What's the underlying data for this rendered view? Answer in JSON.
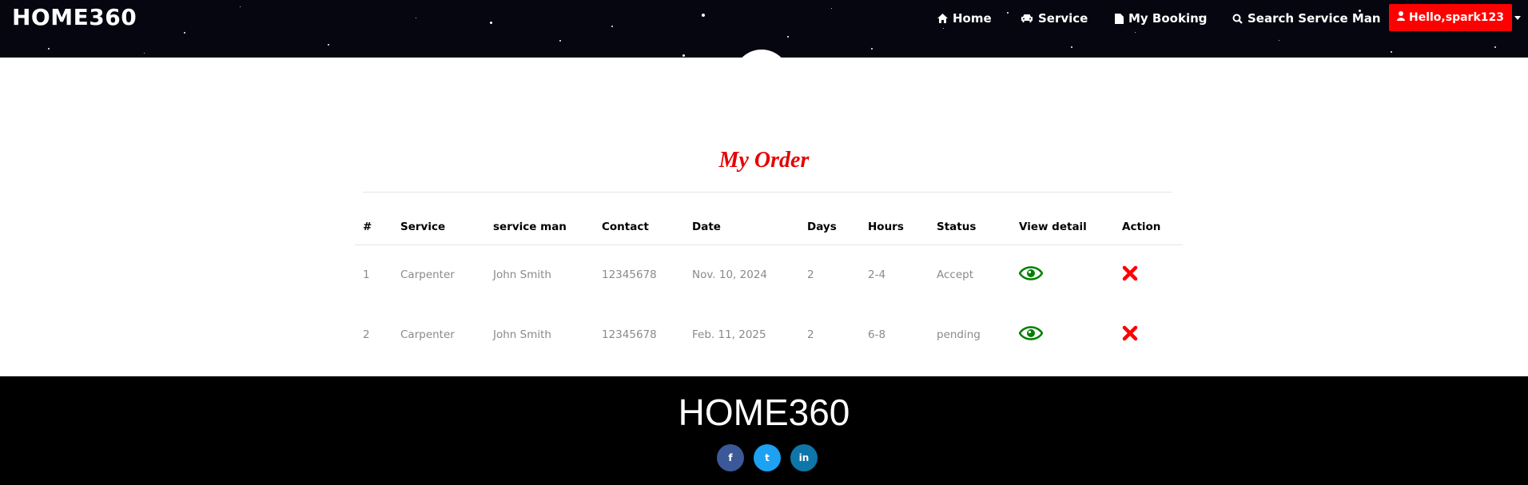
{
  "header": {
    "brand": "HOME360",
    "nav": [
      {
        "label": "Home",
        "icon": "home-icon"
      },
      {
        "label": "Service",
        "icon": "car-icon"
      },
      {
        "label": "My Booking",
        "icon": "file-icon"
      },
      {
        "label": "Search Service Man",
        "icon": "search-icon"
      }
    ],
    "user_button": {
      "label": "Hello,spark123",
      "icon": "user-icon",
      "color": "#ff0000"
    }
  },
  "main": {
    "title": "My Order",
    "title_color": "#e60000",
    "table": {
      "columns": [
        "#",
        "Service",
        "service man",
        "Contact",
        "Date",
        "Days",
        "Hours",
        "Status",
        "View detail",
        "Action"
      ],
      "rows": [
        {
          "num": "1",
          "service": "Carpenter",
          "service_man": "John Smith",
          "contact": "12345678",
          "date": "Nov. 10, 2024",
          "days": "2",
          "hours": "2-4",
          "status": "Accept",
          "view_icon": "eye-icon",
          "action_icon": "delete-x-icon"
        },
        {
          "num": "2",
          "service": "Carpenter",
          "service_man": "John Smith",
          "contact": "12345678",
          "date": "Feb. 11, 2025",
          "days": "2",
          "hours": "6-8",
          "status": "pending",
          "view_icon": "eye-icon",
          "action_icon": "delete-x-icon"
        }
      ],
      "view_icon_color": "#008000",
      "action_icon_color": "#ff0000"
    }
  },
  "footer": {
    "brand": "HOME360",
    "social": [
      {
        "name": "facebook-icon",
        "glyph": "f",
        "color": "#3b5998"
      },
      {
        "name": "twitter-icon",
        "glyph": "t",
        "color": "#1da1f2"
      },
      {
        "name": "linkedin-icon",
        "glyph": "in",
        "color": "#0e76a8"
      }
    ]
  }
}
